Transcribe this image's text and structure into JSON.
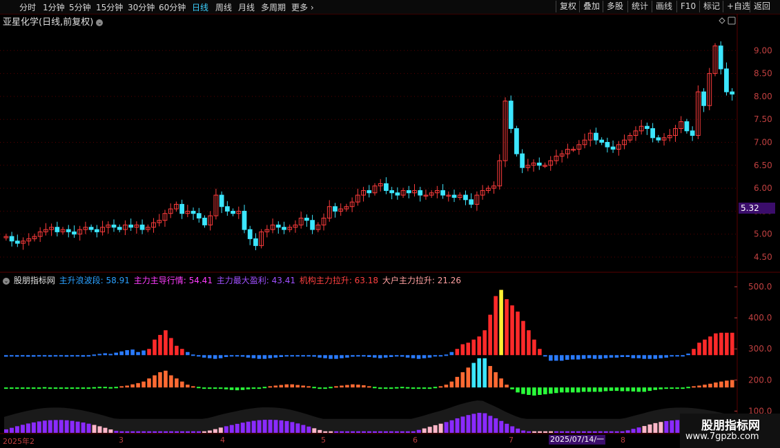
{
  "toolbar": {
    "tabs": [
      "分时",
      "1分钟",
      "5分钟",
      "15分钟",
      "30分钟",
      "60分钟",
      "日线",
      "周线",
      "月线",
      "多周期",
      "更多"
    ],
    "active_tab": "日线",
    "right_buttons": [
      "复权",
      "叠加",
      "多股",
      "统计",
      "画线",
      "F10",
      "标记",
      "+自选",
      "返回"
    ]
  },
  "price_panel": {
    "title": "亚星化学(日线,前复权)",
    "current_price_tag": "5.32"
  },
  "indicator_panel": {
    "name": "股朋指标网",
    "items": [
      {
        "label": "主升浪波段: 58.91",
        "color": "#2aa0ff"
      },
      {
        "label": "主力主导行情: 54.41",
        "color": "#ff3cff"
      },
      {
        "label": "主力最大盈利: 43.41",
        "color": "#a050ff"
      },
      {
        "label": "机构主力拉升: 63.18",
        "color": "#ff4040"
      },
      {
        "label": "大户主力拉升: 21.26",
        "color": "#ffa0a0"
      }
    ]
  },
  "date_axis": {
    "labels": [
      "2025年2",
      "3",
      "4",
      "5",
      "6",
      "7",
      "8"
    ],
    "cursor_date": "2025/07/14/一"
  },
  "watermark": {
    "title": "股朋指标网",
    "url": "www.7gpzb.com"
  },
  "colors": {
    "up": "#ff3c3c",
    "down": "#3ce6ff",
    "grid": "#5a0000",
    "axis_text": "#c04040",
    "accent_tab": "#3cd0ff"
  },
  "chart_data": [
    {
      "type": "candlestick",
      "title": "亚星化学(日线,前复权)",
      "y_ticks": [
        "9.00",
        "8.50",
        "8.00",
        "7.50",
        "7.00",
        "6.50",
        "6.00",
        "5.50",
        "5.00",
        "4.50"
      ],
      "ylim": [
        4.2,
        9.5
      ],
      "close": [
        4.95,
        4.85,
        4.8,
        4.85,
        4.9,
        4.95,
        5.05,
        5.1,
        5.15,
        5.05,
        5.1,
        5.05,
        5.0,
        5.1,
        5.15,
        5.1,
        5.05,
        5.15,
        5.2,
        5.15,
        5.1,
        5.2,
        5.15,
        5.2,
        5.1,
        5.15,
        5.25,
        5.3,
        5.45,
        5.55,
        5.65,
        5.45,
        5.5,
        5.45,
        5.35,
        5.2,
        5.4,
        5.85,
        5.6,
        5.5,
        5.45,
        5.5,
        5.1,
        4.9,
        4.75,
        5.05,
        5.1,
        5.2,
        5.15,
        5.1,
        5.15,
        5.2,
        5.35,
        5.3,
        5.1,
        5.2,
        5.35,
        5.6,
        5.5,
        5.55,
        5.6,
        5.7,
        5.85,
        5.95,
        5.9,
        6.05,
        6.1,
        5.95,
        5.9,
        5.85,
        5.95,
        5.9,
        5.95,
        5.85,
        5.85,
        5.9,
        5.95,
        5.85,
        5.85,
        5.8,
        5.85,
        5.75,
        5.65,
        5.85,
        5.95,
        6.0,
        6.05,
        6.6,
        7.9,
        7.3,
        6.75,
        6.45,
        6.5,
        6.55,
        6.5,
        6.5,
        6.6,
        6.7,
        6.75,
        6.85,
        6.85,
        6.95,
        7.05,
        7.2,
        7.05,
        7.0,
        6.9,
        6.85,
        6.95,
        7.05,
        7.15,
        7.25,
        7.35,
        7.3,
        7.1,
        7.05,
        7.1,
        7.15,
        7.3,
        7.45,
        7.25,
        7.15,
        8.1,
        7.8,
        8.5,
        9.1,
        8.6,
        8.1,
        8.05
      ],
      "ohlc_direction": "computed as close-to-previous-close",
      "current_price": 5.32
    },
    {
      "type": "bar",
      "title": "股朋指标网",
      "series": [
        {
          "name": "主升浪波段",
          "value": 58.91
        },
        {
          "name": "主力主导行情",
          "value": 54.41
        },
        {
          "name": "主力最大盈利",
          "value": 43.41
        },
        {
          "name": "机构主力拉升",
          "value": 63.18
        },
        {
          "name": "大户主力拉升",
          "value": 21.26
        }
      ],
      "y_ticks": [
        "500.0",
        "400.0",
        "300.0",
        "200.0",
        "100.0"
      ],
      "ylim": [
        30,
        540
      ],
      "upper_band": [
        275,
        278,
        275,
        276,
        275,
        275,
        276,
        277,
        275,
        278,
        276,
        275,
        277,
        276,
        275,
        280,
        282,
        284,
        286,
        284,
        288,
        292,
        296,
        298,
        290,
        295,
        300,
        330,
        345,
        360,
        335,
        310,
        300,
        290,
        282,
        276,
        272,
        270,
        268,
        270,
        274,
        278,
        276,
        275,
        272,
        270,
        268,
        268,
        270,
        272,
        274,
        276,
        278,
        280,
        278,
        276,
        275,
        272,
        270,
        268,
        268,
        270,
        272,
        275,
        278,
        276,
        274,
        272,
        270,
        272,
        274,
        276,
        275,
        272,
        270,
        268,
        270,
        272,
        276,
        280,
        282,
        290,
        300,
        315,
        320,
        330,
        340,
        360,
        410,
        470,
        490,
        460,
        440,
        420,
        390,
        360,
        330,
        300,
        280,
        262,
        262,
        262,
        265,
        266,
        266,
        268,
        270,
        268,
        268,
        270,
        272,
        272,
        274,
        274,
        270,
        270,
        268,
        268,
        268,
        270,
        272,
        276,
        278,
        280,
        285,
        300,
        320,
        330,
        340,
        350,
        352,
        352,
        352
      ],
      "lower_band": [
        175,
        175,
        176,
        176,
        176,
        175,
        176,
        177,
        176,
        175,
        176,
        176,
        175,
        175,
        176,
        176,
        177,
        178,
        178,
        177,
        178,
        180,
        182,
        186,
        190,
        195,
        205,
        215,
        225,
        230,
        215,
        205,
        195,
        185,
        180,
        178,
        176,
        174,
        172,
        172,
        170,
        168,
        167,
        168,
        170,
        172,
        175,
        178,
        180,
        182,
        184,
        186,
        186,
        184,
        182,
        180,
        178,
        176,
        176,
        178,
        180,
        182,
        184,
        186,
        185,
        183,
        180,
        178,
        176,
        175,
        176,
        177,
        178,
        177,
        176,
        176,
        175,
        176,
        178,
        180,
        185,
        195,
        210,
        225,
        240,
        255,
        270,
        270,
        245,
        225,
        205,
        185,
        170,
        160,
        155,
        152,
        150,
        152,
        154,
        156,
        158,
        160,
        160,
        160,
        160,
        162,
        162,
        162,
        162,
        164,
        165,
        165,
        164,
        164,
        163,
        162,
        162,
        165,
        168,
        170,
        172,
        173,
        175,
        176,
        178,
        180,
        182,
        185,
        188,
        192,
        195,
        198,
        200
      ]
    }
  ]
}
